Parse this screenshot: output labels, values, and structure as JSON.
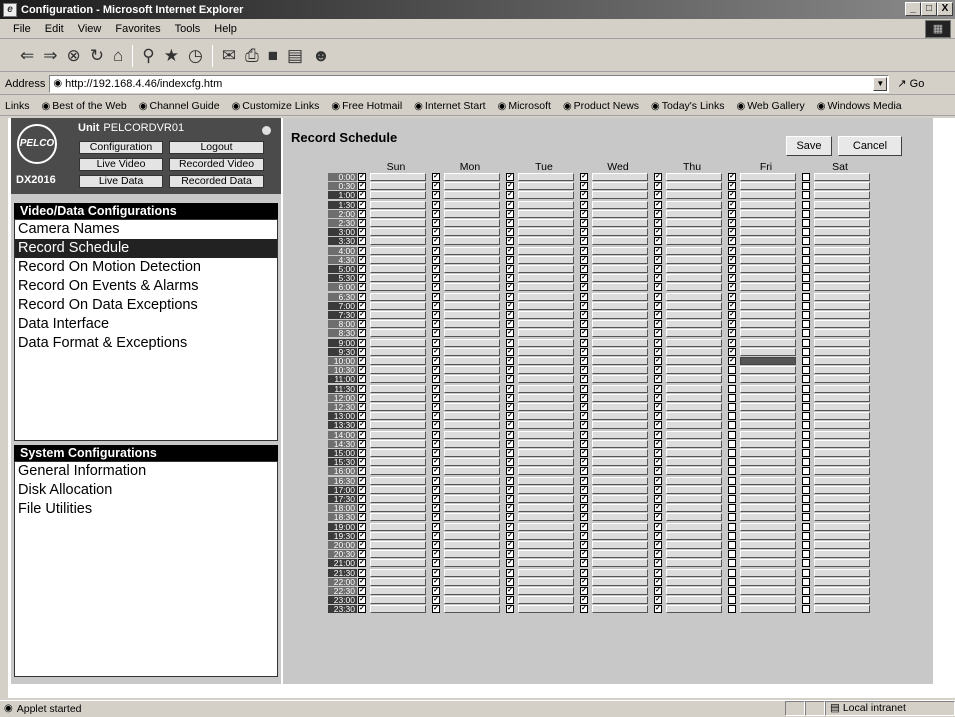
{
  "window": {
    "title": "Configuration - Microsoft Internet Explorer",
    "buttons": [
      "_",
      "□",
      "X"
    ]
  },
  "menu": [
    "File",
    "Edit",
    "View",
    "Favorites",
    "Tools",
    "Help"
  ],
  "address": {
    "label": "Address",
    "url": "http://192.168.4.46/indexcfg.htm",
    "go": "Go"
  },
  "links": {
    "label": "Links",
    "items": [
      "Best of the Web",
      "Channel Guide",
      "Customize Links",
      "Free Hotmail",
      "Internet Start",
      "Microsoft",
      "Product News",
      "Today's Links",
      "Web Gallery",
      "Windows Media"
    ]
  },
  "unit": {
    "logo": "PELCO",
    "label": "Unit",
    "name": "PELCORDVR01",
    "model": "DX2016",
    "nav": [
      "Configuration",
      "Logout",
      "Live Video",
      "Recorded Video",
      "Live Data",
      "Recorded Data"
    ]
  },
  "video_section": {
    "title": "Video/Data Configurations",
    "items": [
      "Camera Names",
      "Record Schedule",
      "Record On Motion Detection",
      "Record On Events & Alarms",
      "Record On Data Exceptions",
      "Data Interface",
      "Data Format & Exceptions"
    ],
    "selected_index": 1
  },
  "system_section": {
    "title": "System Configurations",
    "items": [
      "General Information",
      "Disk Allocation",
      "File Utilities"
    ]
  },
  "schedule": {
    "title": "Record Schedule",
    "save_label": "Save",
    "cancel_label": "Cancel",
    "days": [
      "Sun",
      "Mon",
      "Tue",
      "Wed",
      "Thu",
      "Fri",
      "Sat"
    ],
    "times": [
      "0:00",
      "0:30",
      "1:00",
      "1:30",
      "2:00",
      "2:30",
      "3:00",
      "3:30",
      "4:00",
      "4:30",
      "5:00",
      "5:30",
      "6:00",
      "6:30",
      "7:00",
      "7:30",
      "8:00",
      "8:30",
      "9:00",
      "9:30",
      "10:00",
      "10:30",
      "11:00",
      "11:30",
      "12:00",
      "12:30",
      "13:00",
      "13:30",
      "14:00",
      "14:30",
      "15:00",
      "15:30",
      "16:00",
      "16:30",
      "17:00",
      "17:30",
      "18:00",
      "18:30",
      "19:00",
      "19:30",
      "20:00",
      "20:30",
      "21:00",
      "21:30",
      "22:00",
      "22:30",
      "23:00",
      "23:30"
    ],
    "checked_note": "Sun-Thu checked all slots; Fri checked 0:00-10:00; Sat unchecked",
    "checked_fri_until_slot": 20,
    "highlight_cell": {
      "day": "Fri",
      "time": "10:00"
    }
  },
  "status": {
    "text": "Applet started",
    "zone": "Local intranet"
  }
}
